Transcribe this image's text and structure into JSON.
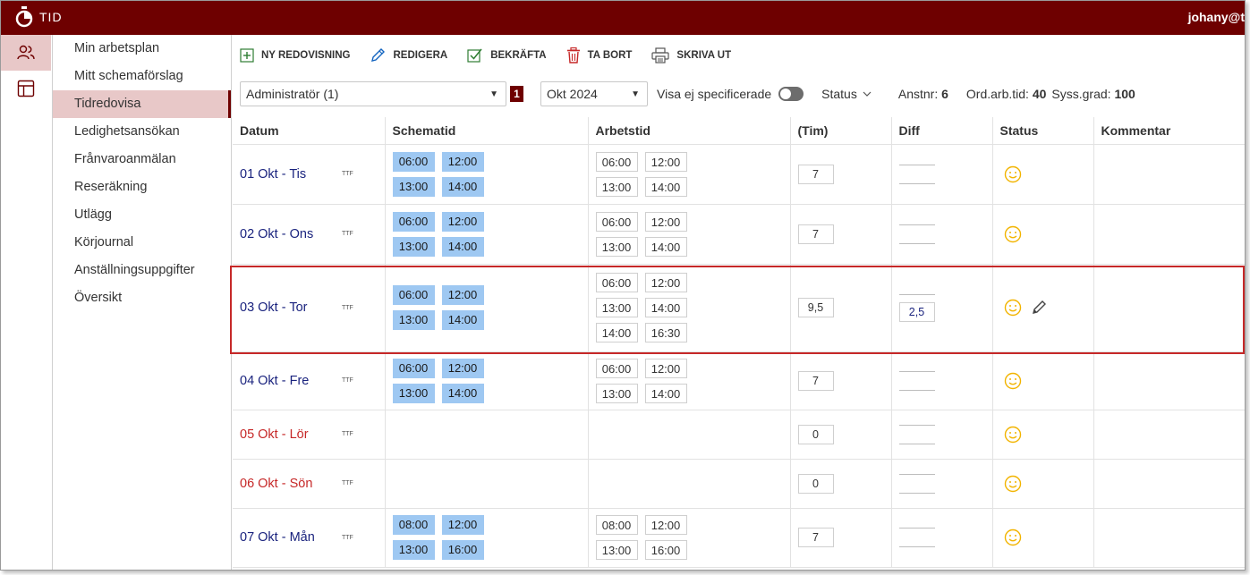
{
  "app": {
    "name": "TID",
    "user": "johany@t"
  },
  "rail": {
    "items": [
      {
        "icon": "users-icon"
      },
      {
        "icon": "layout-icon"
      }
    ]
  },
  "subnav": {
    "items": [
      {
        "label": "Min arbetsplan"
      },
      {
        "label": "Mitt schemaförslag"
      },
      {
        "label": "Tidredovisa",
        "active": true
      },
      {
        "label": "Ledighetsansökan"
      },
      {
        "label": "Frånvaroanmälan"
      },
      {
        "label": "Reseräkning"
      },
      {
        "label": "Utlägg"
      },
      {
        "label": "Körjournal"
      },
      {
        "label": "Anställningsuppgifter"
      },
      {
        "label": "Översikt"
      }
    ]
  },
  "toolbar": {
    "new_label": "NY REDOVISNING",
    "edit_label": "REDIGERA",
    "confirm_label": "BEKRÄFTA",
    "delete_label": "TA BORT",
    "print_label": "SKRIVA UT"
  },
  "filters": {
    "role": "Administratör (1)",
    "role_badge": "1",
    "period": "Okt 2024",
    "show_unspecified": "Visa ej specificerade",
    "status_label": "Status",
    "anstnr_label": "Anstnr:",
    "anstnr_value": "6",
    "ordarb_label": "Ord.arb.tid:",
    "ordarb_value": "40",
    "syss_label": "Syss.grad:",
    "syss_value": "100"
  },
  "table": {
    "headers": {
      "datum": "Datum",
      "schematid": "Schematid",
      "arbetstid": "Arbetstid",
      "tim": "(Tim)",
      "diff": "Diff",
      "status": "Status",
      "kommentar": "Kommentar"
    },
    "rows": [
      {
        "date": "01 Okt - Tis",
        "tag": "TTF",
        "weekend": false,
        "schedule": [
          "06:00",
          "12:00",
          "13:00",
          "14:00"
        ],
        "work": [
          "06:00",
          "12:00",
          "13:00",
          "14:00"
        ],
        "tim": "7",
        "diff": "",
        "edit": false
      },
      {
        "date": "02 Okt - Ons",
        "tag": "TTF",
        "weekend": false,
        "schedule": [
          "06:00",
          "12:00",
          "13:00",
          "14:00"
        ],
        "work": [
          "06:00",
          "12:00",
          "13:00",
          "14:00"
        ],
        "tim": "7",
        "diff": "",
        "edit": false
      },
      {
        "date": "03 Okt - Tor",
        "tag": "TTF",
        "weekend": false,
        "schedule": [
          "06:00",
          "12:00",
          "13:00",
          "14:00"
        ],
        "work": [
          "06:00",
          "12:00",
          "13:00",
          "14:00",
          "14:00",
          "16:30"
        ],
        "tim": "9,5",
        "diff": "2,5",
        "edit": true
      },
      {
        "date": "04 Okt - Fre",
        "tag": "TTF",
        "weekend": false,
        "schedule": [
          "06:00",
          "12:00",
          "13:00",
          "14:00"
        ],
        "work": [
          "06:00",
          "12:00",
          "13:00",
          "14:00"
        ],
        "tim": "7",
        "diff": "",
        "edit": false
      },
      {
        "date": "05 Okt - Lör",
        "tag": "TTF",
        "weekend": true,
        "schedule": [],
        "work": [],
        "tim": "0",
        "diff": "",
        "edit": false
      },
      {
        "date": "06 Okt - Sön",
        "tag": "TTF",
        "weekend": true,
        "schedule": [],
        "work": [],
        "tim": "0",
        "diff": "",
        "edit": false
      },
      {
        "date": "07 Okt - Mån",
        "tag": "TTF",
        "weekend": false,
        "schedule": [
          "08:00",
          "12:00",
          "13:00",
          "16:00"
        ],
        "work": [
          "08:00",
          "12:00",
          "13:00",
          "16:00"
        ],
        "tim": "7",
        "diff": "",
        "edit": false
      }
    ]
  },
  "colors": {
    "brand": "#6e0000",
    "active_bg": "#e8c8c8",
    "sched_chip": "#9ec8f2",
    "highlight": "#c62828",
    "weekend": "#c62828",
    "date": "#1a237e"
  }
}
